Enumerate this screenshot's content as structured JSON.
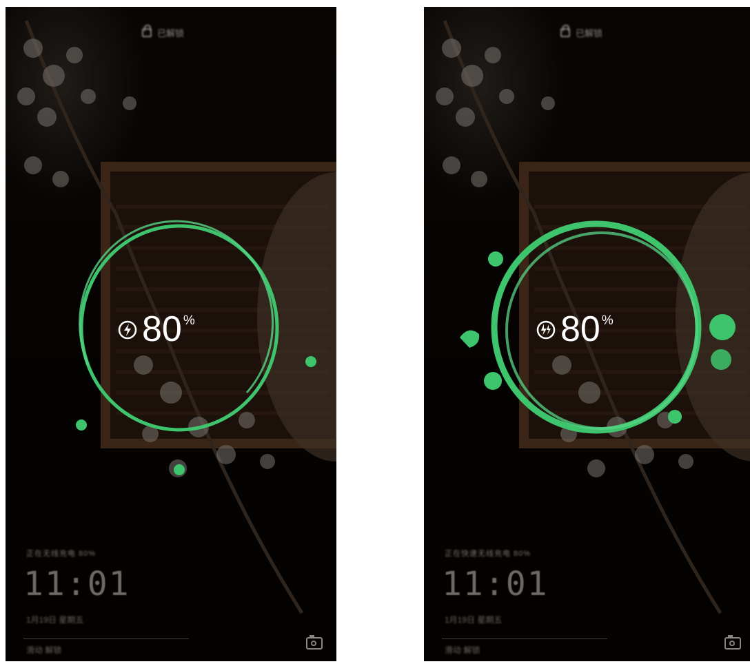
{
  "screens": [
    {
      "lock_status_text": "已解锁",
      "charging_status_text": "正在无线充电 80%",
      "clock": "11:01",
      "date": "1月19日 星期五",
      "unlock_hint": "滑动 解锁",
      "battery_value": "80",
      "battery_unit": "%",
      "state": "charging-ring"
    },
    {
      "lock_status_text": "已解锁",
      "charging_status_text": "正在快速无线充电 80%",
      "clock": "11:01",
      "date": "1月19日 星期五",
      "unlock_hint": "滑动 解锁",
      "battery_value": "80",
      "battery_unit": "%",
      "state": "super-charging-ring"
    }
  ],
  "colors": {
    "ring_green": "#3ec46d",
    "ring_green_light": "#58d487",
    "text_white": "#ffffff"
  },
  "icons": {
    "charge": "wireless-charging-bolt-icon",
    "lock": "unlock-icon",
    "camera": "camera-icon"
  }
}
